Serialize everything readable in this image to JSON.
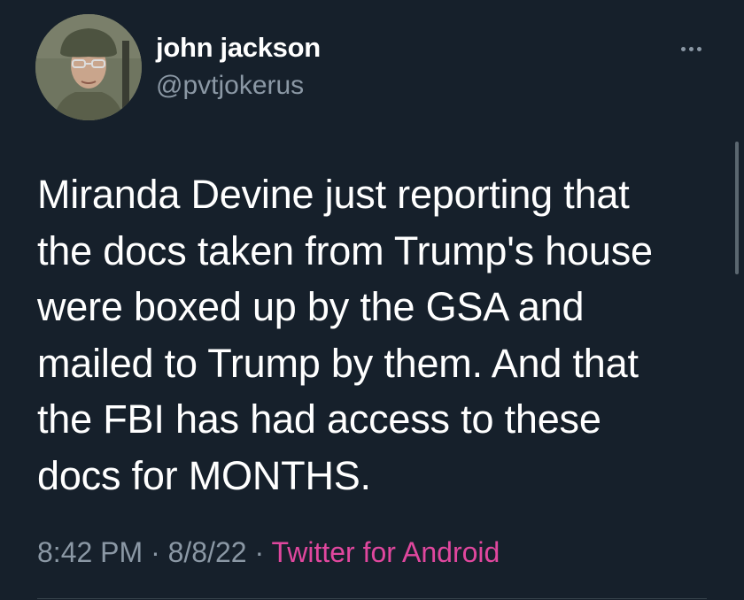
{
  "tweet": {
    "author": {
      "display_name": "john jackson",
      "handle": "@pvtjokerus"
    },
    "text": "Miranda Devine just reporting that\nthe docs taken from Trump's house\nwere boxed up by the GSA and\nmailed to Trump by them. And that\nthe FBI has had access to these\ndocs for MONTHS.",
    "time": "8:42 PM",
    "separator": "·",
    "date": "8/8/22",
    "source": "Twitter for Android",
    "more_icon": "more-horizontal-icon"
  },
  "colors": {
    "background": "#16202b",
    "text": "#ffffff",
    "secondary_text": "#8b98a5",
    "source_link": "#e0479e"
  }
}
